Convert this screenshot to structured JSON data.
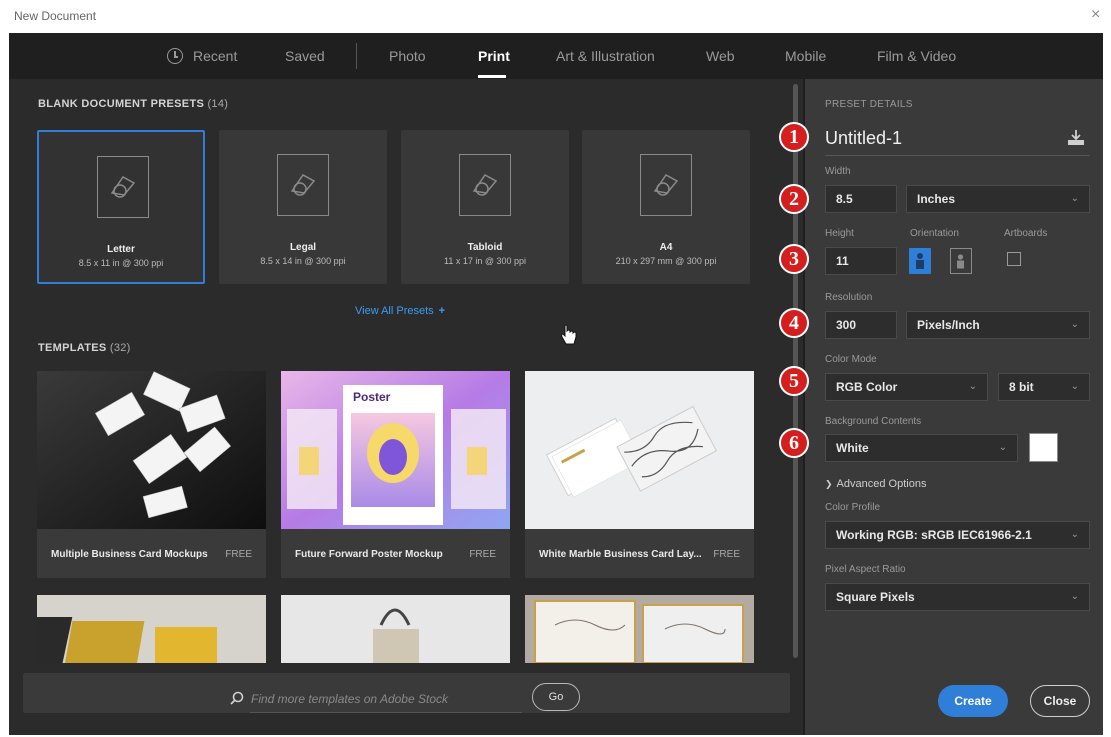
{
  "window": {
    "title": "New Document",
    "close": "×"
  },
  "tabs": [
    {
      "label": "Recent"
    },
    {
      "label": "Saved"
    },
    {
      "label": "Photo"
    },
    {
      "label": "Print"
    },
    {
      "label": "Art & Illustration"
    },
    {
      "label": "Web"
    },
    {
      "label": "Mobile"
    },
    {
      "label": "Film & Video"
    }
  ],
  "presets_section": {
    "title": "BLANK DOCUMENT PRESETS",
    "count": "(14)"
  },
  "presets": [
    {
      "name": "Letter",
      "dims": "8.5 x 11 in @ 300 ppi"
    },
    {
      "name": "Legal",
      "dims": "8.5 x 14 in @ 300 ppi"
    },
    {
      "name": "Tabloid",
      "dims": "11 x 17 in @ 300 ppi"
    },
    {
      "name": "A4",
      "dims": "210 x 297 mm @ 300 ppi"
    }
  ],
  "view_all": {
    "label": "View All Presets",
    "plus": "+"
  },
  "templates_section": {
    "title": "TEMPLATES",
    "count": "(32)"
  },
  "templates": [
    {
      "name": "Multiple Business Card Mockups",
      "badge": "FREE"
    },
    {
      "name": "Future Forward Poster Mockup",
      "badge": "FREE",
      "thumb_text": "Poster"
    },
    {
      "name": "White Marble Business Card Lay...",
      "badge": "FREE"
    }
  ],
  "search": {
    "placeholder": "Find more templates on Adobe Stock",
    "go": "Go"
  },
  "details": {
    "heading": "PRESET DETAILS",
    "doc_name": "Untitled-1",
    "width_label": "Width",
    "width_value": "8.5",
    "width_unit": "Inches",
    "height_label": "Height",
    "height_value": "11",
    "orientation_label": "Orientation",
    "artboards_label": "Artboards",
    "resolution_label": "Resolution",
    "resolution_value": "300",
    "resolution_unit": "Pixels/Inch",
    "color_mode_label": "Color Mode",
    "color_mode_value": "RGB Color",
    "bit_depth": "8 bit",
    "bg_label": "Background Contents",
    "bg_value": "White",
    "bg_color": "#ffffff",
    "advanced_label": "Advanced Options",
    "color_profile_label": "Color Profile",
    "color_profile_value": "Working RGB: sRGB IEC61966-2.1",
    "pixel_aspect_label": "Pixel Aspect Ratio",
    "pixel_aspect_value": "Square Pixels"
  },
  "badges": [
    "1",
    "2",
    "3",
    "4",
    "5",
    "6"
  ],
  "buttons": {
    "create": "Create",
    "close": "Close"
  },
  "colors": {
    "accent": "#2f7fd9",
    "badge": "#d51f1f",
    "panel": "#2b2b2b",
    "details_panel": "#3a3a3a"
  }
}
